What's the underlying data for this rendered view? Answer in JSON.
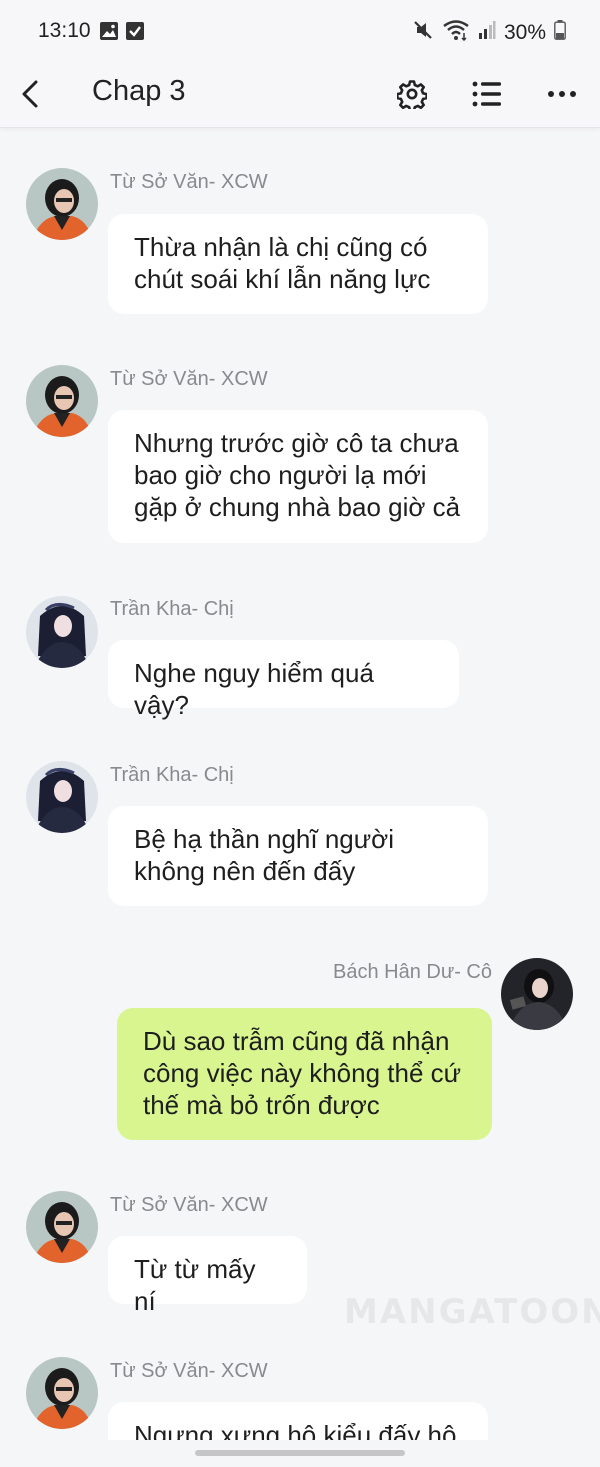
{
  "status_bar": {
    "time": "13:10",
    "battery": "30%",
    "left_icons": [
      "image-icon",
      "checkbox-icon"
    ],
    "right_icons": [
      "mute-icon",
      "wifi-icon",
      "signal-icon",
      "battery-icon"
    ]
  },
  "header": {
    "title": "Chap 3",
    "icons": [
      "back-icon",
      "gear-icon",
      "list-icon",
      "more-icon"
    ]
  },
  "messages": [
    {
      "sender": "Từ Sở Văn- XCW",
      "text_lines": [
        "Thừa nhận là chị cũng có",
        "chút soái khí lẫn năng lực"
      ],
      "side": "left"
    },
    {
      "sender": "Từ Sở Văn- XCW",
      "text_lines": [
        "Nhưng trước giờ cô ta chưa",
        "bao giờ cho người lạ mới",
        "gặp ở chung nhà bao giờ cả"
      ],
      "side": "left"
    },
    {
      "sender": "Trần Kha- Chị",
      "text_lines": [
        "Nghe nguy hiểm quá vậy?"
      ],
      "side": "left"
    },
    {
      "sender": "Trần Kha- Chị",
      "text_lines": [
        "Bệ hạ thần nghĩ người",
        "không nên đến đấy"
      ],
      "side": "left"
    },
    {
      "sender": "Bách Hân Dư- Cô",
      "text_lines": [
        "Dù sao trẫm cũng đã nhận",
        "công việc này không thể cứ",
        "thế mà bỏ trốn được"
      ],
      "side": "right"
    },
    {
      "sender": "Từ Sở Văn- XCW",
      "text_lines": [
        "Từ từ mấy ní"
      ],
      "side": "left"
    },
    {
      "sender": "Từ Sở Văn- XCW",
      "text_lines": [
        "Ngưng xưng hô kiểu đấy hộ"
      ],
      "side": "left"
    }
  ],
  "watermark": "MANGATOON",
  "colors": {
    "background": "#f5f6f8",
    "bubble_other": "#ffffff",
    "bubble_mine": "#d8f590",
    "name_text": "#8a8a8e"
  }
}
